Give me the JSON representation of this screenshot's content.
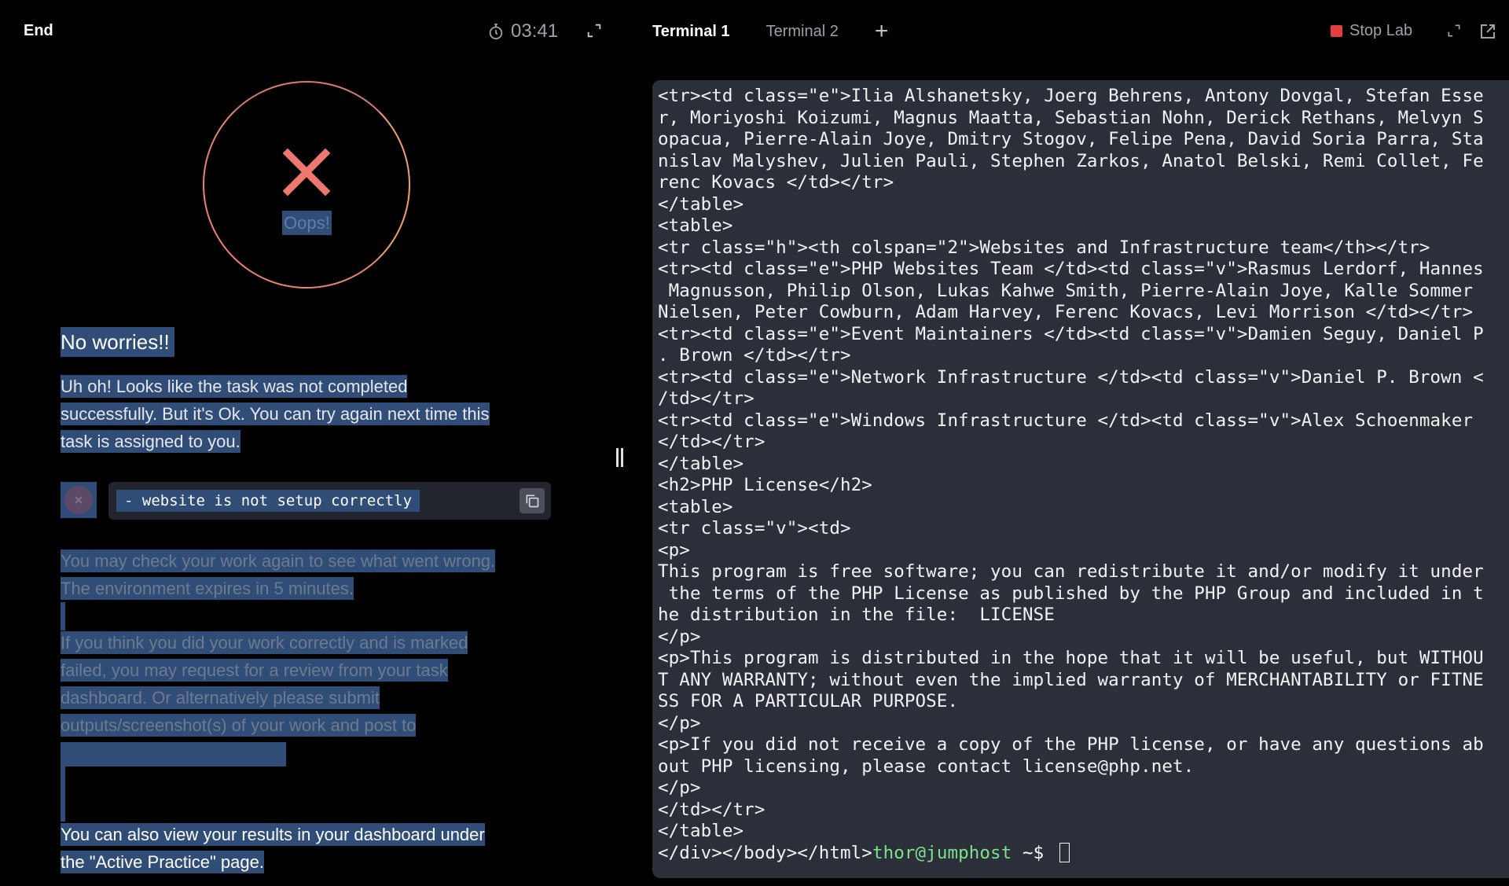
{
  "left": {
    "end_label": "End",
    "timer": "03:41",
    "result_label": "Oops!",
    "title": "No worries!!",
    "sorry_lines": [
      "Uh oh! Looks like the task was not completed",
      "successfully. But it's Ok. You can try again next time this",
      "task is assigned to you."
    ],
    "error_message": "- website is not setup correctly",
    "check_lines": [
      "You may check your work again to see what went wrong.",
      "The environment expires in 5 minutes."
    ],
    "review_lines": [
      "If you think you did your work correctly and is marked",
      "failed, you may request for a review from your task",
      "dashboard. Or alternatively please submit",
      "outputs/screenshot(s) of your work and post to"
    ],
    "results_lines": [
      "You can also view your results in your dashboard under",
      "the \"Active Practice\" page."
    ]
  },
  "right": {
    "tabs": [
      "Terminal 1",
      "Terminal 2"
    ],
    "add_tab": "+",
    "stop_lab": "Stop Lab",
    "terminal_lines": [
      "<tr><td class=\"e\">Ilia Alshanetsky, Joerg Behrens, Antony Dovgal, Stefan Esse",
      "r, Moriyoshi Koizumi, Magnus Maatta, Sebastian Nohn, Derick Rethans, Melvyn S",
      "opacua, Pierre-Alain Joye, Dmitry Stogov, Felipe Pena, David Soria Parra, Sta",
      "nislav Malyshev, Julien Pauli, Stephen Zarkos, Anatol Belski, Remi Collet, Fe",
      "renc Kovacs </td></tr>",
      "</table>",
      "<table>",
      "<tr class=\"h\"><th colspan=\"2\">Websites and Infrastructure team</th></tr>",
      "<tr><td class=\"e\">PHP Websites Team </td><td class=\"v\">Rasmus Lerdorf, Hannes",
      " Magnusson, Philip Olson, Lukas Kahwe Smith, Pierre-Alain Joye, Kalle Sommer",
      "Nielsen, Peter Cowburn, Adam Harvey, Ferenc Kovacs, Levi Morrison </td></tr>",
      "<tr><td class=\"e\">Event Maintainers </td><td class=\"v\">Damien Seguy, Daniel P",
      ". Brown </td></tr>",
      "<tr><td class=\"e\">Network Infrastructure </td><td class=\"v\">Daniel P. Brown <",
      "/td></tr>",
      "<tr><td class=\"e\">Windows Infrastructure </td><td class=\"v\">Alex Schoenmaker",
      "</td></tr>",
      "</table>",
      "<h2>PHP License</h2>",
      "<table>",
      "<tr class=\"v\"><td>",
      "<p>",
      "This program is free software; you can redistribute it and/or modify it under",
      " the terms of the PHP License as published by the PHP Group and included in t",
      "he distribution in the file:  LICENSE",
      "</p>",
      "<p>This program is distributed in the hope that it will be useful, but WITHOU",
      "T ANY WARRANTY; without even the implied warranty of MERCHANTABILITY or FITNE",
      "SS FOR A PARTICULAR PURPOSE.",
      "</p>",
      "<p>If you did not receive a copy of the PHP license, or have any questions ab",
      "out PHP licensing, please contact license@php.net.",
      "</p>",
      "</td></tr>",
      "</table>"
    ],
    "last_line_output": "</div></body></html>",
    "prompt_user": "thor@jumphost",
    "prompt_path": " ~$ "
  },
  "colors": {
    "selection": "#2f4d77",
    "terminal_bg": "#2b2f3a",
    "prompt_green": "#7fe08a",
    "fail_red": "#f0776e",
    "stop_red": "#e53e3e"
  }
}
